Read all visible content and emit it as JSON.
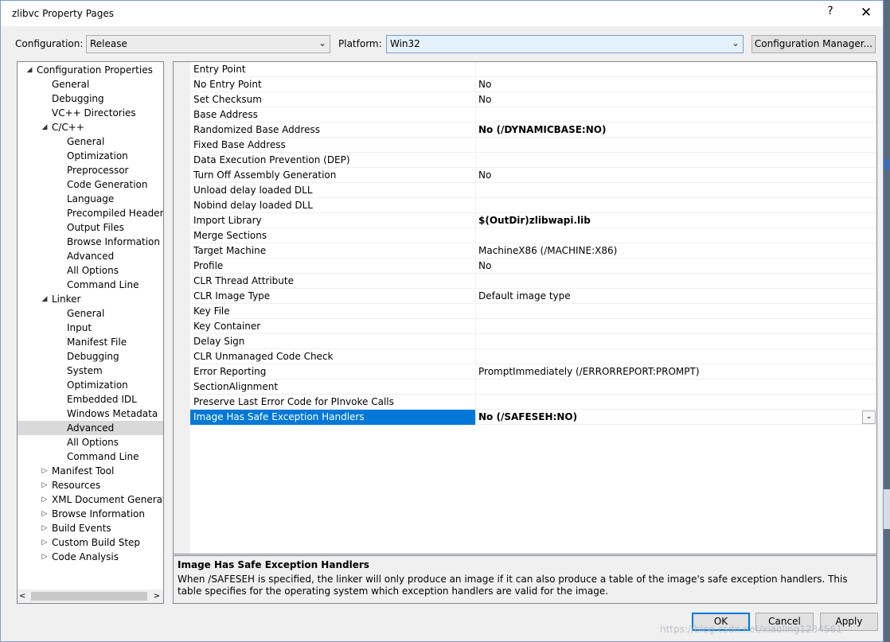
{
  "window": {
    "title": "zlibvc Property Pages",
    "help_glyph": "?",
    "close_glyph": "✕"
  },
  "config": {
    "label": "Configuration:",
    "value": "Release"
  },
  "platform": {
    "label": "Platform:",
    "value": "Win32"
  },
  "config_manager_label": "Configuration Manager...",
  "tree": {
    "root": "Configuration Properties",
    "general": "General",
    "debugging": "Debugging",
    "vcpp": "VC++ Directories",
    "cpp": "C/C++",
    "cpp_items": [
      "General",
      "Optimization",
      "Preprocessor",
      "Code Generation",
      "Language",
      "Precompiled Headers",
      "Output Files",
      "Browse Information",
      "Advanced",
      "All Options",
      "Command Line"
    ],
    "linker": "Linker",
    "linker_items": [
      "General",
      "Input",
      "Manifest File",
      "Debugging",
      "System",
      "Optimization",
      "Embedded IDL",
      "Windows Metadata",
      "Advanced",
      "All Options",
      "Command Line"
    ],
    "more": [
      "Manifest Tool",
      "Resources",
      "XML Document Generator",
      "Browse Information",
      "Build Events",
      "Custom Build Step",
      "Code Analysis"
    ]
  },
  "properties": [
    {
      "name": "Entry Point",
      "value": ""
    },
    {
      "name": "No Entry Point",
      "value": "No"
    },
    {
      "name": "Set Checksum",
      "value": "No"
    },
    {
      "name": "Base Address",
      "value": ""
    },
    {
      "name": "Randomized Base Address",
      "value": "No (/DYNAMICBASE:NO)"
    },
    {
      "name": "Fixed Base Address",
      "value": ""
    },
    {
      "name": "Data Execution Prevention (DEP)",
      "value": ""
    },
    {
      "name": "Turn Off Assembly Generation",
      "value": "No"
    },
    {
      "name": "Unload delay loaded DLL",
      "value": ""
    },
    {
      "name": "Nobind delay loaded DLL",
      "value": ""
    },
    {
      "name": "Import Library",
      "value": "$(OutDir)zlibwapi.lib"
    },
    {
      "name": "Merge Sections",
      "value": ""
    },
    {
      "name": "Target Machine",
      "value": "MachineX86 (/MACHINE:X86)"
    },
    {
      "name": "Profile",
      "value": "No"
    },
    {
      "name": "CLR Thread Attribute",
      "value": ""
    },
    {
      "name": "CLR Image Type",
      "value": "Default image type"
    },
    {
      "name": "Key File",
      "value": ""
    },
    {
      "name": "Key Container",
      "value": ""
    },
    {
      "name": "Delay Sign",
      "value": ""
    },
    {
      "name": "CLR Unmanaged Code Check",
      "value": ""
    },
    {
      "name": "Error Reporting",
      "value": "PromptImmediately (/ERRORREPORT:PROMPT)"
    },
    {
      "name": "SectionAlignment",
      "value": ""
    },
    {
      "name": "Preserve Last Error Code for PInvoke Calls",
      "value": ""
    },
    {
      "name": "Image Has Safe Exception Handlers",
      "value": "No (/SAFESEH:NO)"
    }
  ],
  "description": {
    "title": "Image Has Safe Exception Handlers",
    "body": "When /SAFESEH is specified, the linker will only produce an image if it can also produce a table of the image's safe exception handlers. This table specifies for the operating system which exception handlers are valid for the image."
  },
  "buttons": {
    "ok": "OK",
    "cancel": "Cancel",
    "apply": "Apply"
  },
  "watermark": "https://blog.csdn.net/xiaoling1234561"
}
